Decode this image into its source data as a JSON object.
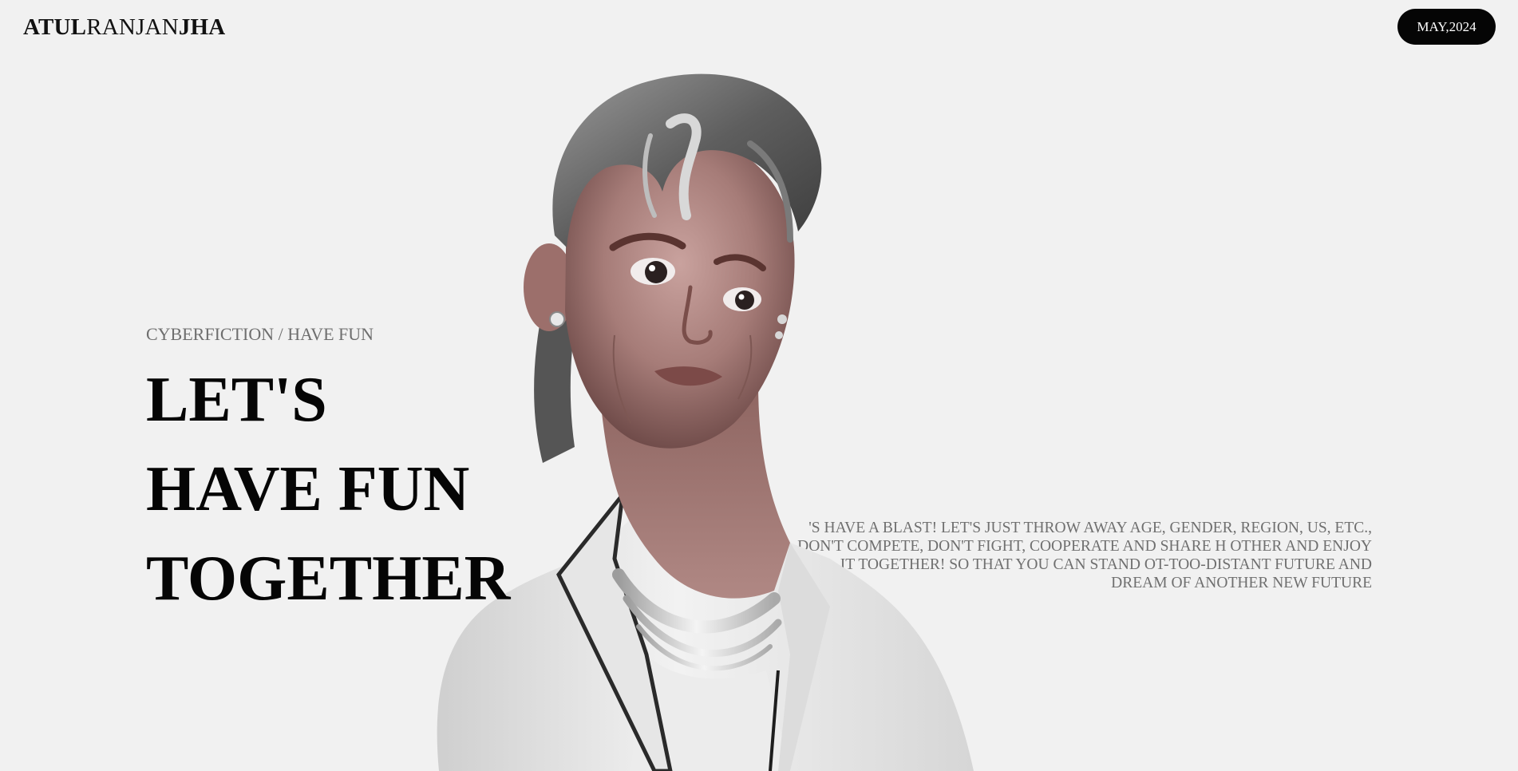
{
  "header": {
    "brand_bold_first": "ATUL",
    "brand_regular": "RANJAN",
    "brand_bold_last": "JHA",
    "date_label": "MAY,2024"
  },
  "hero": {
    "kicker": "CYBERFICTION / HAVE FUN",
    "headline_lines": [
      "LET'S",
      "HAVE FUN",
      "TOGETHER"
    ]
  },
  "manifesto": {
    "text": "'S HAVE A BLAST! LET'S JUST THROW AWAY AGE, GENDER, REGION, US, ETC., DON'T COMPETE, DON'T FIGHT, COOPERATE AND SHARE H OTHER AND ENJOY IT TOGETHER! SO THAT YOU CAN STAND OT-TOO-DISTANT FUTURE AND DREAM OF ANOTHER NEW FUTURE"
  },
  "colors": {
    "background": "#f1f1f1",
    "pill": "#050505",
    "headline": "#050505",
    "muted_text": "#6f6f6f"
  },
  "illustration": {
    "icon": "3d-character-portrait"
  }
}
